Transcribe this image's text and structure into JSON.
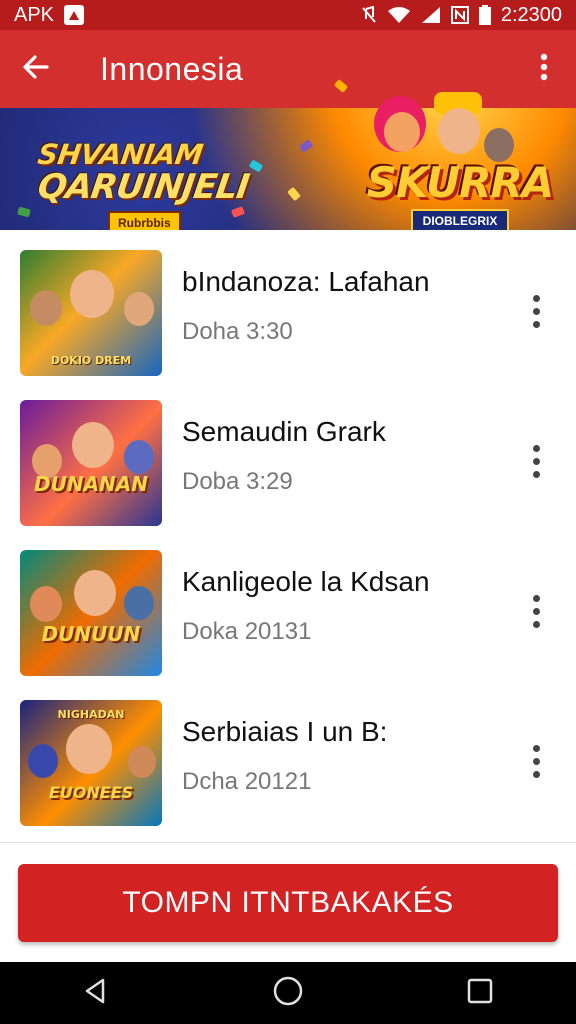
{
  "status_bar": {
    "carrier_label": "APK",
    "time": "2:2300",
    "icons": [
      "apk-icon",
      "mute-icon",
      "wifi-icon",
      "signal-icon",
      "nfc-icon",
      "battery-icon"
    ]
  },
  "app_bar": {
    "title": "Innonesia",
    "back_icon": "arrow-left-icon",
    "menu_icon": "more-vert-icon"
  },
  "banner": {
    "left_line1": "SHVANIAM",
    "left_line2": "QARUINJELI",
    "left_badge": "Rubrbbis",
    "right_title": "SKURRA",
    "right_badge": "DIOBLEGRIX",
    "page_count": 3,
    "active_page": 2
  },
  "items": [
    {
      "title": "bIndanoza: Lafahan",
      "subtitle": "Doha 3:30",
      "thumb_label": "",
      "thumb_toplabel": "DOKIO DREM",
      "palette": [
        "#2e7d32",
        "#f9a825",
        "#1565c0"
      ]
    },
    {
      "title": "Semaudin Grark",
      "subtitle": "Doba 3:29",
      "thumb_label": "DUNANAN",
      "thumb_toplabel": "",
      "palette": [
        "#6a1b9a",
        "#ff7043",
        "#283593"
      ]
    },
    {
      "title": "Kanligeole la Kdsan",
      "subtitle": "Doka 20131",
      "thumb_label": "DUNUUN",
      "thumb_toplabel": "",
      "palette": [
        "#00897b",
        "#ef6c00",
        "#1e88e5"
      ]
    },
    {
      "title": "Serbiaias I un B:",
      "subtitle": "Dcha 20121",
      "thumb_label": "EUONEES",
      "thumb_toplabel": "NIGHADAN",
      "palette": [
        "#1a237e",
        "#ff8f00",
        "#0277bd"
      ]
    }
  ],
  "cta": {
    "label": "TOMPN ITNTBAKAKÉS"
  },
  "nav_bar": {
    "icons": [
      "back-triangle-icon",
      "home-circle-icon",
      "recents-square-icon"
    ]
  },
  "colors": {
    "primary": "#d32f2f",
    "status": "#b71c1c",
    "cta": "#d32222"
  }
}
